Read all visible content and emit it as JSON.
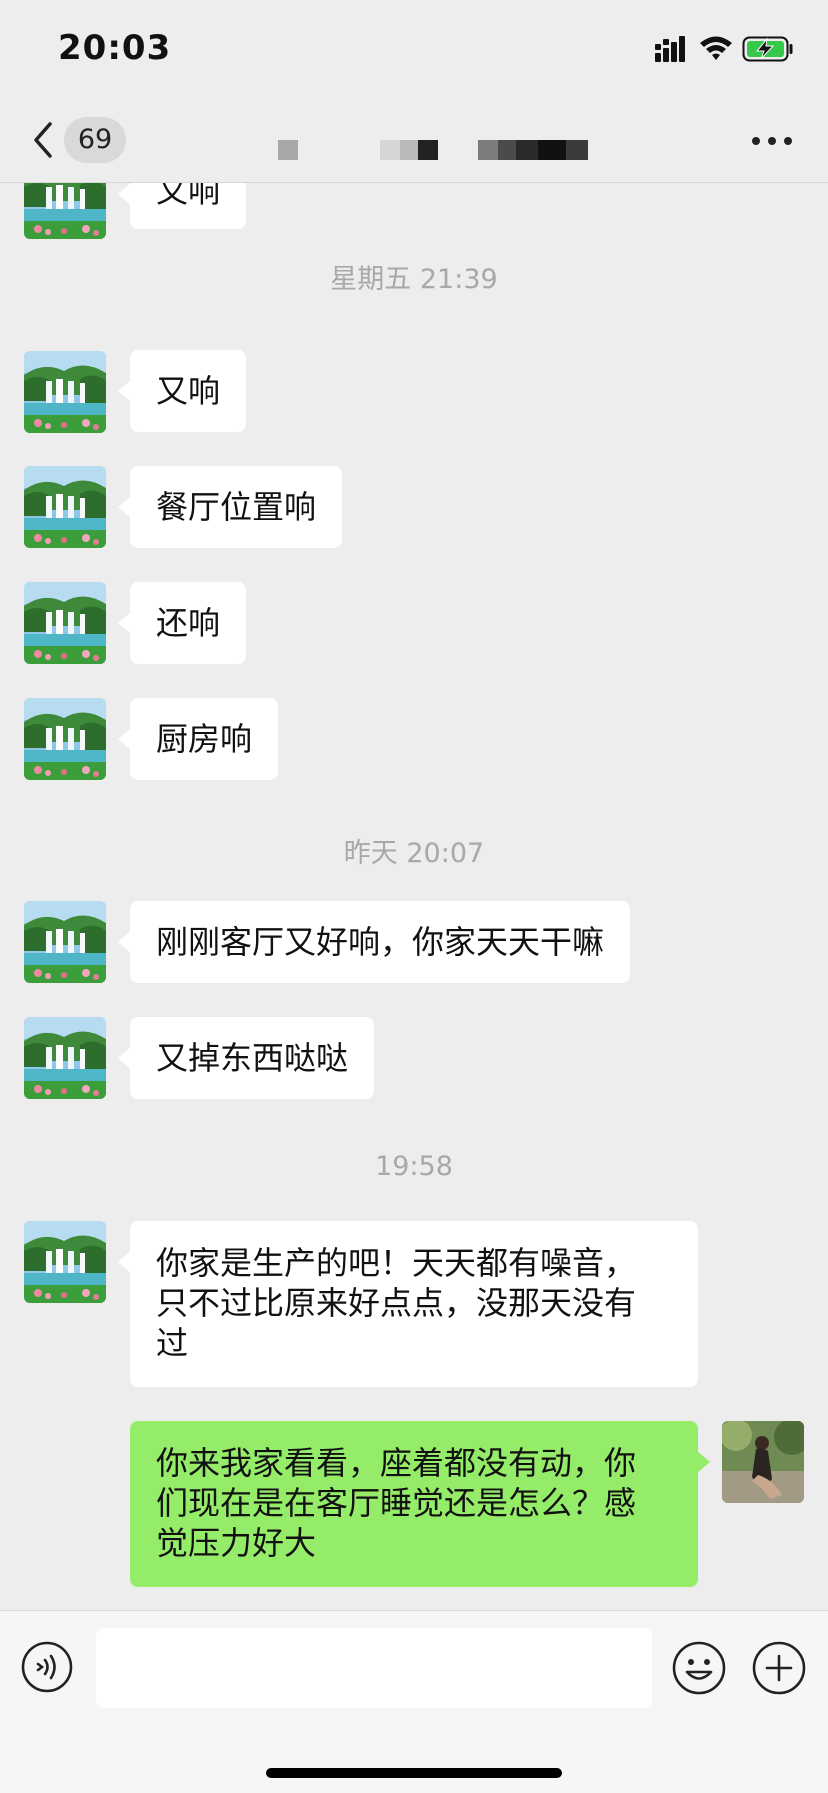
{
  "status_bar": {
    "time": "20:03",
    "battery_state": "charging"
  },
  "nav": {
    "unread_count": "69",
    "back_icon": "chevron-left-icon",
    "more_icon": "ellipsis-icon"
  },
  "colors": {
    "background": "#ededed",
    "incoming_bubble": "#ffffff",
    "outgoing_bubble": "#95ec69",
    "timestamp": "#a8a8a8"
  },
  "chat": {
    "partial_top": {
      "text": "又响"
    },
    "timestamps": [
      "星期五 21:39",
      "昨天 20:07",
      "19:58"
    ],
    "messages": [
      {
        "sender": "other",
        "text": "又响"
      },
      {
        "sender": "other",
        "text": "餐厅位置响"
      },
      {
        "sender": "other",
        "text": "还响"
      },
      {
        "sender": "other",
        "text": "厨房响"
      },
      {
        "sender": "other",
        "text": "刚刚客厅又好响，你家天天干嘛"
      },
      {
        "sender": "other",
        "text": "又掉东西哒哒"
      },
      {
        "sender": "other",
        "lines": [
          "你家是生产的吧！天天都有噪音，",
          "只不过比原来好点点，没那天没有",
          "过"
        ]
      },
      {
        "sender": "me",
        "lines": [
          "你来我家看看，座着都没有动，你",
          "们现在是在客厅睡觉还是怎么？感",
          "觉压力好大"
        ]
      }
    ]
  },
  "input_bar": {
    "voice_icon": "voice-icon",
    "emoji_icon": "emoji-icon",
    "plus_icon": "plus-icon",
    "placeholder": ""
  }
}
